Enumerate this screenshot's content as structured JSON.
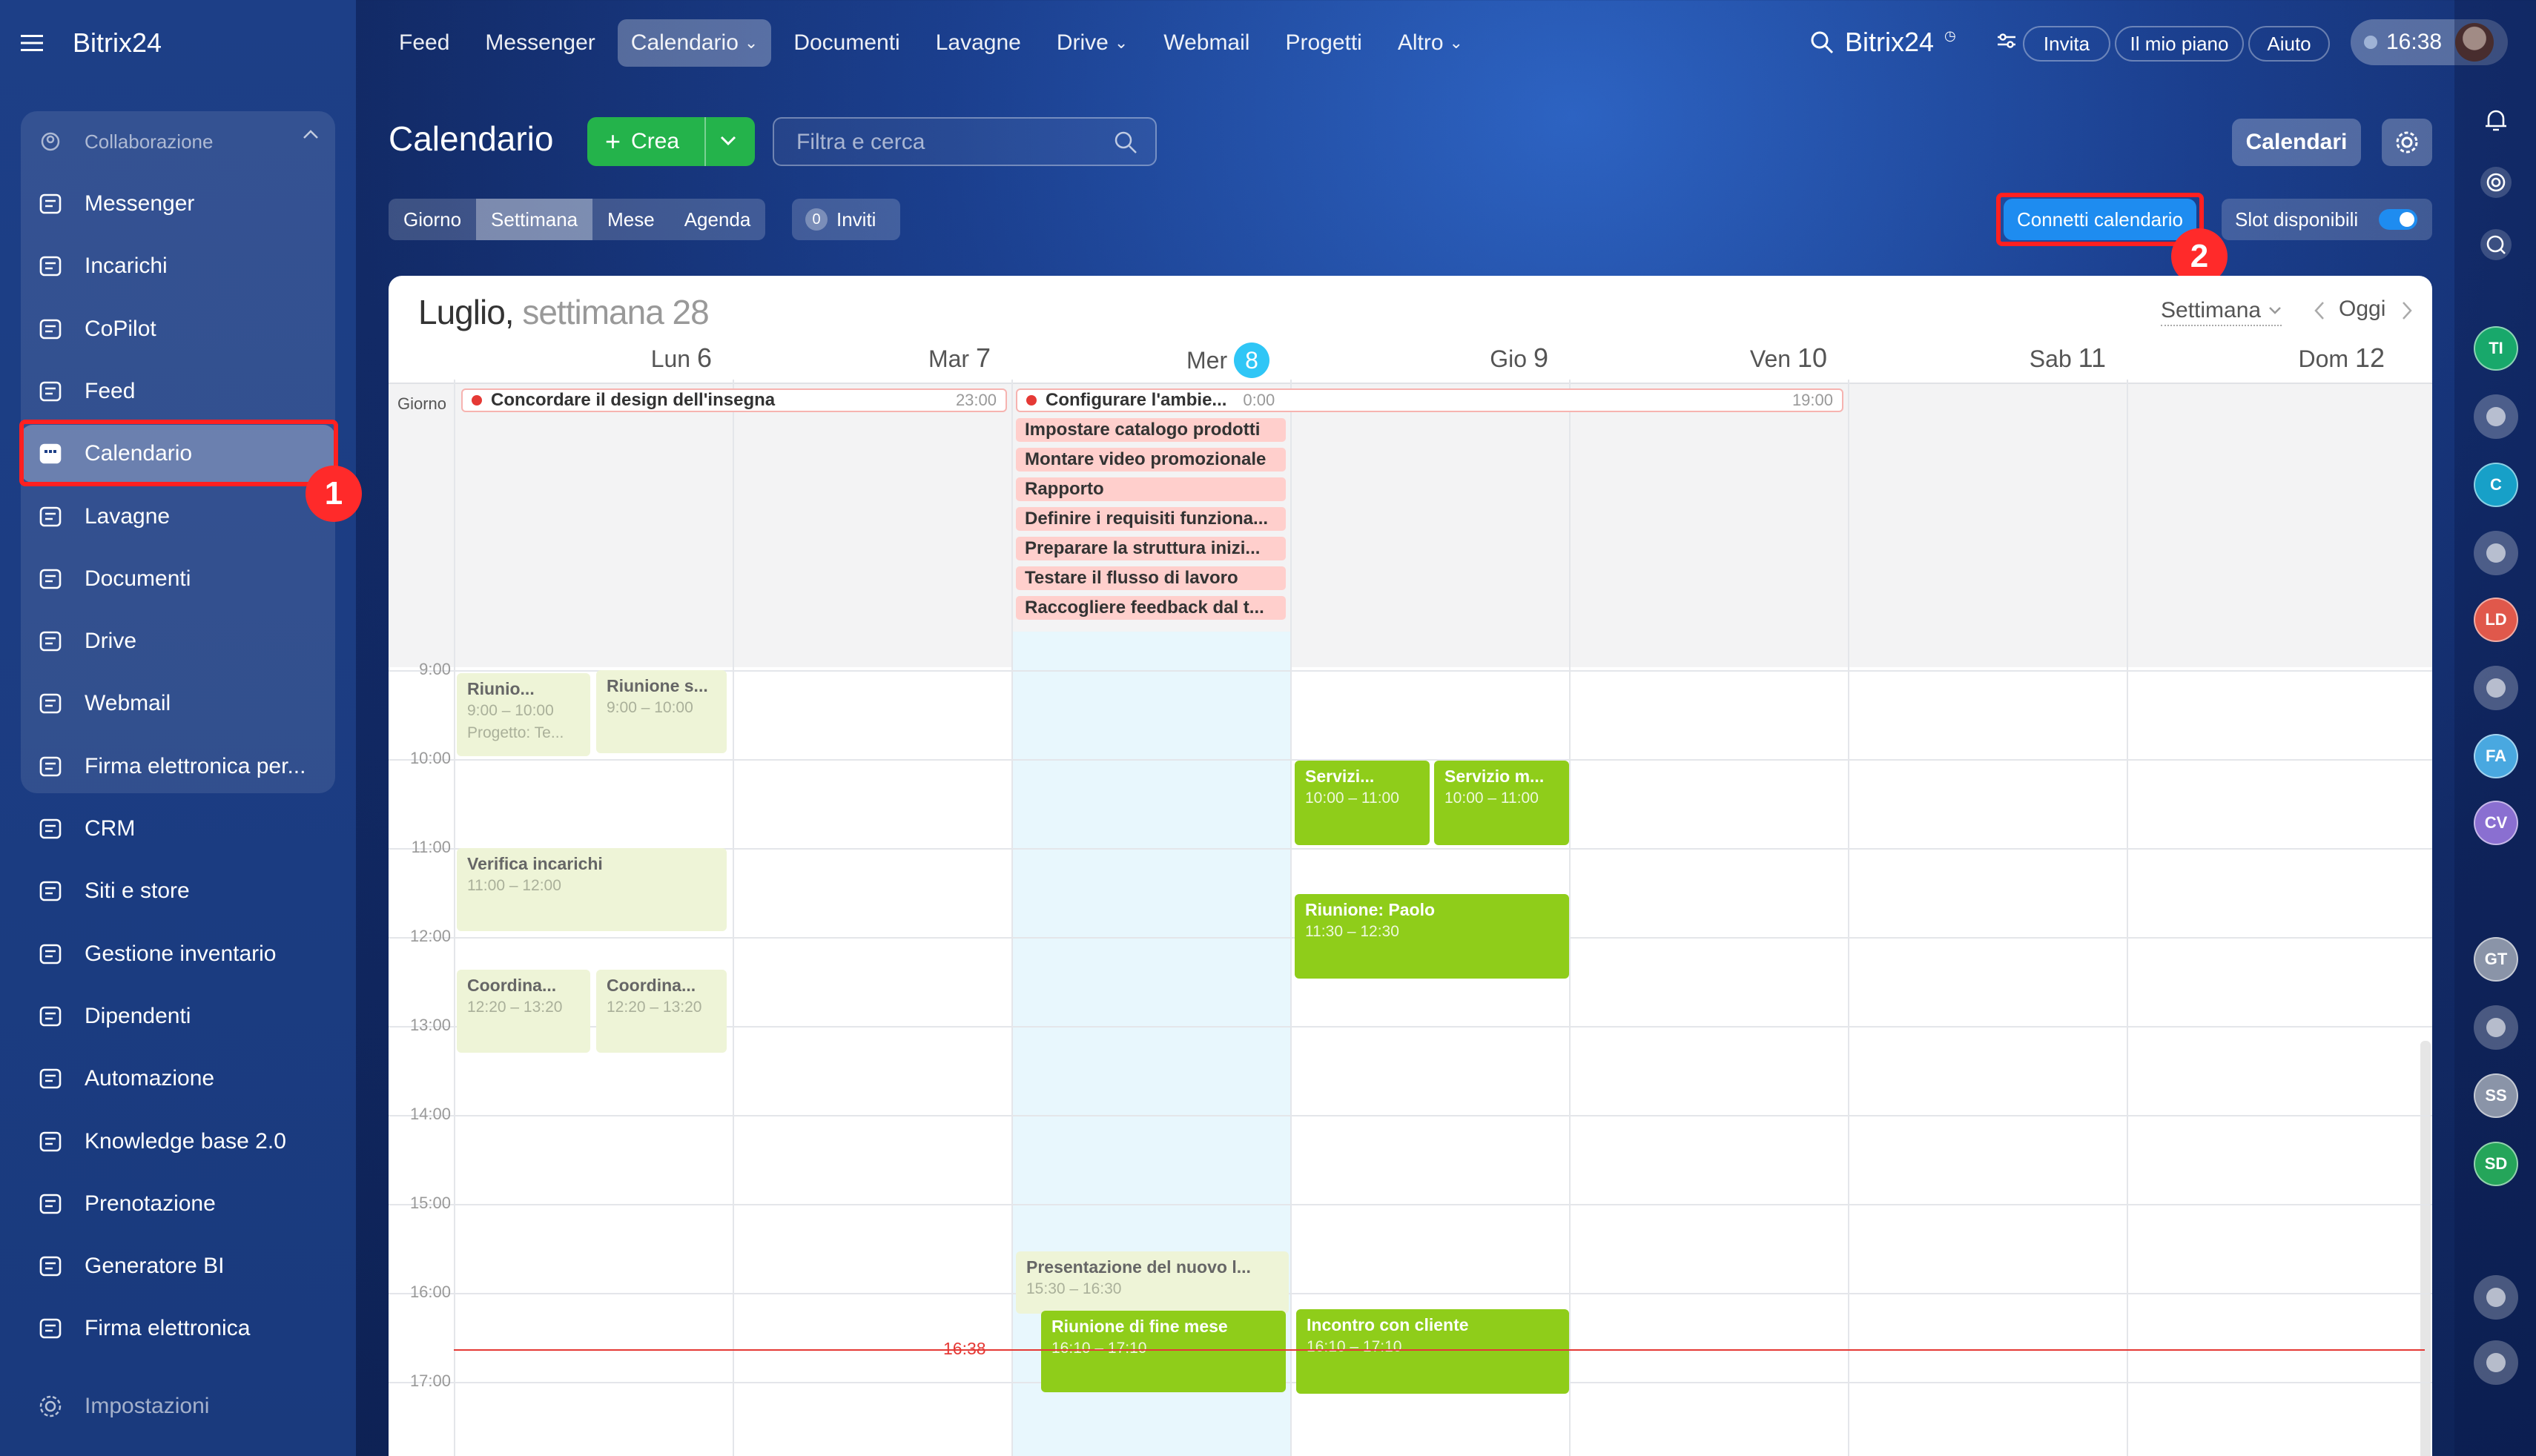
{
  "app": {
    "logo": "Bitrix24",
    "header_logo": "Bitrix24",
    "time": "16:38"
  },
  "top_nav": [
    {
      "label": "Feed"
    },
    {
      "label": "Messenger"
    },
    {
      "label": "Calendario",
      "dropdown": true,
      "active": true
    },
    {
      "label": "Documenti"
    },
    {
      "label": "Lavagne"
    },
    {
      "label": "Drive",
      "dropdown": true
    },
    {
      "label": "Webmail"
    },
    {
      "label": "Progetti"
    },
    {
      "label": "Altro",
      "dropdown": true
    }
  ],
  "header_buttons": {
    "invite": "Invita",
    "plan": "Il mio piano",
    "help": "Aiuto"
  },
  "sidebar": {
    "group_title": "Collaborazione",
    "items": [
      "Messenger",
      "Incarichi",
      "CoPilot",
      "Feed",
      "Calendario",
      "Lavagne",
      "Documenti",
      "Drive",
      "Webmail",
      "Firma elettronica per...",
      "CRM",
      "Siti e store",
      "Gestione inventario",
      "Dipendenti",
      "Automazione",
      "Knowledge base 2.0",
      "Prenotazione",
      "Generatore BI",
      "Firma elettronica"
    ],
    "settings": "Impostazioni"
  },
  "calendar": {
    "title": "Calendario",
    "create_label": "Crea",
    "search_placeholder": "Filtra e cerca",
    "calendars_btn": "Calendari",
    "views": [
      "Giorno",
      "Settimana",
      "Mese",
      "Agenda"
    ],
    "invites_count": "0",
    "invites_label": "Inviti",
    "connect_label": "Connetti calendario",
    "slots_label": "Slot disponibili",
    "week_title_bold": "Luglio,",
    "week_title_light": "settimana 28",
    "view_select": "Settimana",
    "today": "Oggi",
    "days": [
      {
        "name": "Lun",
        "num": "6"
      },
      {
        "name": "Mar",
        "num": "7"
      },
      {
        "name": "Mer",
        "num": "8"
      },
      {
        "name": "Gio",
        "num": "9"
      },
      {
        "name": "Ven",
        "num": "10"
      },
      {
        "name": "Sab",
        "num": "11"
      },
      {
        "name": "Dom",
        "num": "12"
      }
    ],
    "allday_label": "Giorno",
    "allday_events": [
      {
        "title": "Concordare il design dell'insegna",
        "end": "23:00"
      },
      {
        "title": "Configurare l'ambie...",
        "start": "0:00",
        "end": "19:00"
      }
    ],
    "wed_allday": [
      "Impostare catalogo prodotti",
      "Montare video promozionale",
      "Rapporto",
      "Definire i requisiti funziona...",
      "Preparare la struttura inizi...",
      "Testare il flusso di lavoro",
      "Raccogliere feedback dal t..."
    ],
    "hours": [
      "9:00",
      "10:00",
      "11:00",
      "12:00",
      "13:00",
      "14:00",
      "15:00",
      "16:00",
      "17:00"
    ],
    "events": [
      {
        "title": "Riunio...",
        "time": "9:00 – 10:00",
        "extra": "Progetto: Te..."
      },
      {
        "title": "Riunione s...",
        "time": "9:00 – 10:00"
      },
      {
        "title": "Verifica incarichi",
        "time": "11:00 – 12:00"
      },
      {
        "title": "Coordina...",
        "time": "12:20 – 13:20"
      },
      {
        "title": "Coordina...",
        "time": "12:20 – 13:20"
      },
      {
        "title": "Servizi...",
        "time": "10:00 – 11:00"
      },
      {
        "title": "Servizio m...",
        "time": "10:00 – 11:00"
      },
      {
        "title": "Riunione: Paolo",
        "time": "11:30 – 12:30"
      },
      {
        "title": "Presentazione del nuovo l...",
        "time": "15:30 – 16:30"
      },
      {
        "title": "Riunione di fine mese",
        "time": "16:10 – 17:10"
      },
      {
        "title": "Incontro con cliente",
        "time": "16:10 – 17:10"
      }
    ],
    "now_label": "16:38"
  },
  "annotations": {
    "one": "1",
    "two": "2"
  },
  "right_avatars": [
    "TI",
    "C",
    "LD",
    "FA",
    "CV",
    "GT",
    "SS",
    "SD"
  ],
  "colors": {
    "accent_green": "#8fcd1a",
    "light_green": "#eef4d7",
    "pink": "#ffcfcc",
    "today_col": "#e8f7fd",
    "now_line": "#e53935",
    "connect_btn": "#1e8cf0"
  }
}
